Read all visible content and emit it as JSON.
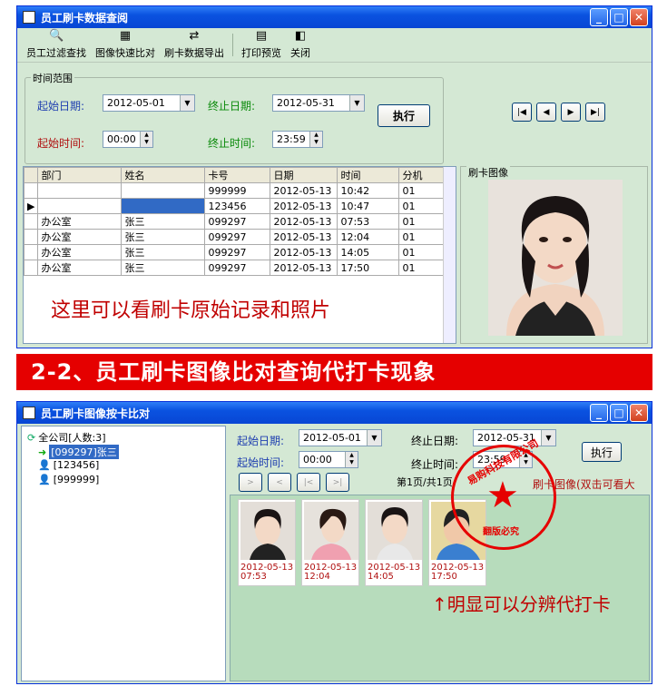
{
  "top_window": {
    "title": "员工刷卡数据查阅",
    "toolbar": [
      "员工过滤查找",
      "图像快速比对",
      "刷卡数据导出",
      "打印预览",
      "关闭"
    ],
    "fieldset_legend": "时间范围",
    "start_date_label": "起始日期:",
    "start_date_value": "2012-05-01",
    "end_date_label": "终止日期:",
    "end_date_value": "2012-05-31",
    "start_time_label": "起始时间:",
    "start_time_value": "00:00",
    "end_time_label": "终止时间:",
    "end_time_value": "23:59",
    "execute_label": "执行",
    "table_headers": [
      "部门",
      "姓名",
      "卡号",
      "日期",
      "时间",
      "分机"
    ],
    "rows": [
      [
        "",
        "",
        "999999",
        "2012-05-13",
        "10:42",
        "01"
      ],
      [
        "",
        "",
        "123456",
        "2012-05-13",
        "10:47",
        "01"
      ],
      [
        "办公室",
        "张三",
        "099297",
        "2012-05-13",
        "07:53",
        "01"
      ],
      [
        "办公室",
        "张三",
        "099297",
        "2012-05-13",
        "12:04",
        "01"
      ],
      [
        "办公室",
        "张三",
        "099297",
        "2012-05-13",
        "14:05",
        "01"
      ],
      [
        "办公室",
        "张三",
        "099297",
        "2012-05-13",
        "17:50",
        "01"
      ]
    ],
    "photo_panel_label": "刷卡图像",
    "annotation": "这里可以看刷卡原始记录和照片"
  },
  "banner": "2-2、员工刷卡图像比对查询代打卡现象",
  "bottom_window": {
    "title": "员工刷卡图像按卡比对",
    "tree": [
      "全公司[人数:3]",
      "[099297]张三",
      "[123456]",
      "[999999]"
    ],
    "start_date_label": "起始日期:",
    "start_date_value": "2012-05-01",
    "end_date_label": "终止日期:",
    "end_date_value": "2012-05-31",
    "start_time_label": "起始时间:",
    "start_time_value": "00:00",
    "end_time_label": "终止时间:",
    "end_time_value": "23:59",
    "execute_label": "执行",
    "page_info": "第1页/共1页",
    "hint": "刷卡图像(双击可看大",
    "thumbs": [
      {
        "date": "2012-05-13",
        "time": "07:53"
      },
      {
        "date": "2012-05-13",
        "time": "12:04"
      },
      {
        "date": "2012-05-13",
        "time": "14:05"
      },
      {
        "date": "2012-05-13",
        "time": "17:50"
      }
    ],
    "annotation": "↑明显可以分辨代打卡",
    "stamp_ring": "易购科技有限公司",
    "stamp_text": "翻版必究"
  }
}
